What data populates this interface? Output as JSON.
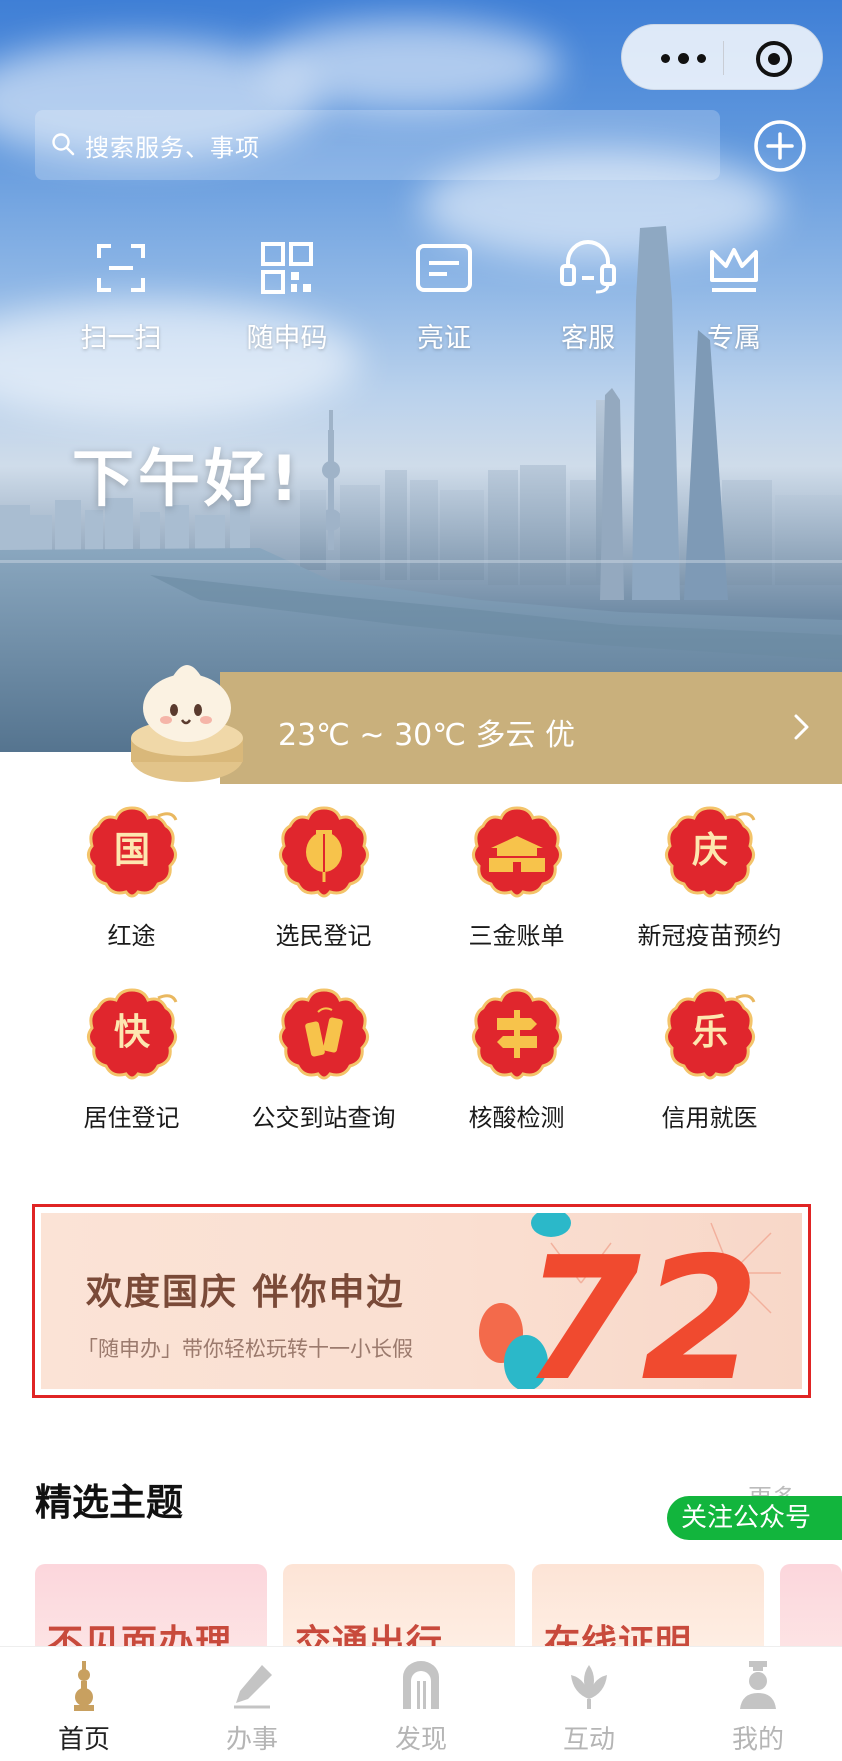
{
  "capsule": {
    "more_icon": "more-dots-icon",
    "close_icon": "close-miniprogram-icon"
  },
  "search": {
    "placeholder": "搜索服务、事项",
    "icon": "search-icon"
  },
  "add_icon": "plus-circle-icon",
  "quick_actions": [
    {
      "label": "扫一扫",
      "icon": "scan-icon"
    },
    {
      "label": "随申码",
      "icon": "qrcode-icon"
    },
    {
      "label": "亮证",
      "icon": "card-icon"
    },
    {
      "label": "客服",
      "icon": "headset-icon"
    },
    {
      "label": "专属",
      "icon": "crown-icon"
    }
  ],
  "greeting": "下午好!",
  "weather": {
    "text": "23℃ ~ 30℃ 多云 优"
  },
  "services": [
    {
      "label": "红途",
      "badge_char": "国"
    },
    {
      "label": "选民登记",
      "badge_char": ""
    },
    {
      "label": "三金账单",
      "badge_char": ""
    },
    {
      "label": "新冠疫苗预约",
      "badge_char": "庆"
    },
    {
      "label": "居住登记",
      "badge_char": "快"
    },
    {
      "label": "公交到站查询",
      "badge_char": ""
    },
    {
      "label": "核酸检测",
      "badge_char": ""
    },
    {
      "label": "信用就医",
      "badge_char": "乐"
    }
  ],
  "banner": {
    "title": "欢度国庆 伴你申边",
    "subtitle": "「随申办」带你轻松玩转十一小长假",
    "number": "72"
  },
  "featured": {
    "title": "精选主题",
    "more": "更多",
    "follow_button": "关注公众号",
    "cards": [
      "不见面办理",
      "交通出行",
      "在线证明"
    ]
  },
  "tabs": [
    {
      "label": "首页",
      "icon": "pagoda-icon",
      "active": true
    },
    {
      "label": "办事",
      "icon": "pen-icon",
      "active": false
    },
    {
      "label": "发现",
      "icon": "arch-icon",
      "active": false
    },
    {
      "label": "互动",
      "icon": "magnolia-icon",
      "active": false
    },
    {
      "label": "我的",
      "icon": "person-icon",
      "active": false
    }
  ],
  "colors": {
    "weather_bar": "#c9b07c",
    "follow_green": "#12b53d",
    "banner_border": "#e02424",
    "badge_red": "#e0262d"
  }
}
